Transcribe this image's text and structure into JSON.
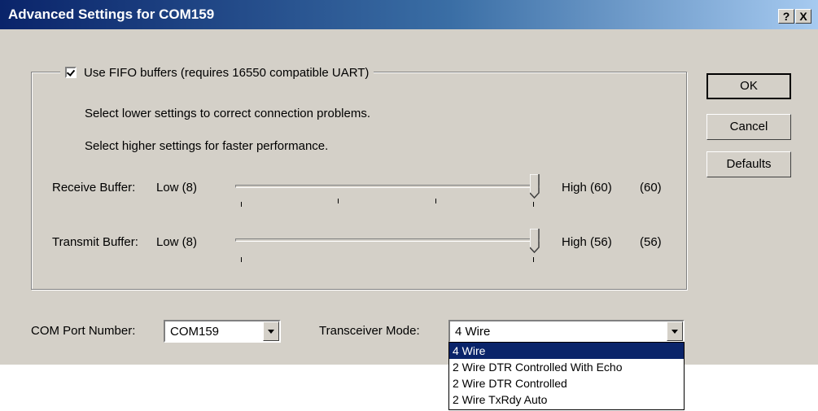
{
  "window": {
    "title": "Advanced Settings for COM159",
    "help_label": "?",
    "close_label": "X"
  },
  "fifo": {
    "label": "Use FIFO buffers (requires 16550 compatible UART)",
    "checked": true,
    "hint_lower": "Select lower settings to correct connection problems.",
    "hint_higher": "Select higher settings for faster performance."
  },
  "receive": {
    "label": "Receive Buffer:",
    "low": "Low (8)",
    "high": "High (60)",
    "value": "(60)",
    "level": 1.0
  },
  "transmit": {
    "label": "Transmit Buffer:",
    "low": "Low (8)",
    "high": "High (56)",
    "value": "(56)",
    "level": 1.0
  },
  "buttons": {
    "ok": "OK",
    "cancel": "Cancel",
    "defaults": "Defaults"
  },
  "com_port": {
    "label": "COM Port Number:",
    "value": "COM159"
  },
  "transceiver": {
    "label": "Transceiver Mode:",
    "value": "4 Wire",
    "options": [
      "4 Wire",
      "2 Wire DTR Controlled With Echo",
      "2 Wire DTR Controlled",
      "2 Wire TxRdy Auto"
    ],
    "selected_index": 0
  }
}
